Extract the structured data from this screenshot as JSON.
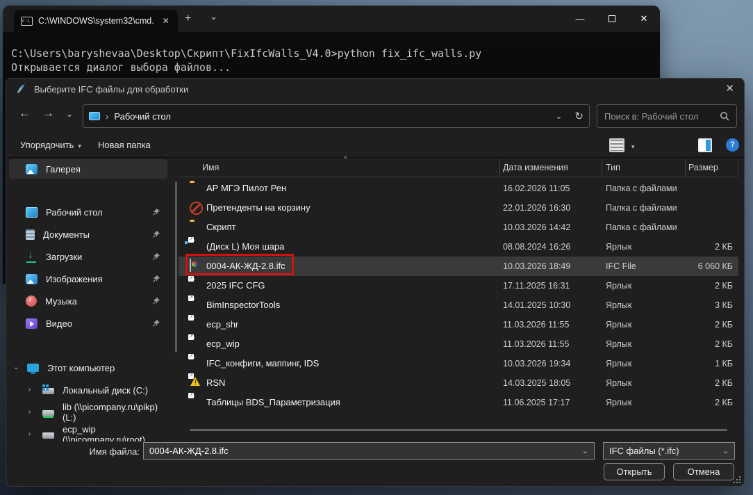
{
  "terminal": {
    "tab_title": "C:\\WINDOWS\\system32\\cmd.",
    "tab_close": "✕",
    "new_tab": "+",
    "tab_dropdown": "⌄",
    "minimize": "—",
    "close": "✕",
    "lines": [
      "C:\\Users\\baryshevaa\\Desktop\\Скрипт\\FixIfcWalls_V4.0>python fix_ifc_walls.py",
      "Открывается диалог выбора файлов..."
    ]
  },
  "dialog": {
    "title": "Выберите IFC файлы для обработки",
    "close": "✕",
    "nav": {
      "back": "←",
      "forward": "→",
      "recent": "⌄",
      "up": "↑"
    },
    "breadcrumb": {
      "sep": "›",
      "path": "Рабочий стол",
      "dropdown": "⌄",
      "refresh": "↻"
    },
    "search": {
      "placeholder": "Поиск в: Рабочий стол"
    },
    "toolbar": {
      "organize": "Упорядочить",
      "organize_caret": "▾",
      "new_folder": "Новая папка",
      "view_caret": "▾",
      "help": "?"
    },
    "sidebar": {
      "gallery": "Галерея",
      "quick": [
        {
          "label": "Рабочий стол",
          "icon": "si-desktop"
        },
        {
          "label": "Документы",
          "icon": "si-docs"
        },
        {
          "label": "Загрузки",
          "icon": "si-downloads"
        },
        {
          "label": "Изображения",
          "icon": "si-pictures"
        },
        {
          "label": "Музыка",
          "icon": "si-music"
        },
        {
          "label": "Видео",
          "icon": "si-video"
        }
      ],
      "tree_chevron_open": "⌄",
      "tree_chevron_closed": "›",
      "computer": "Этот компьютер",
      "drives": [
        {
          "label": "Локальный диск (C:)",
          "icon": "si-drive-c"
        },
        {
          "label": "lib (\\\\picompany.ru\\pikp) (L:)",
          "icon": "si-drive-net"
        },
        {
          "label": "ecp_wip (\\\\picompany.ru\\root)",
          "icon": "si-drive-plain"
        }
      ]
    },
    "list": {
      "sort_caret": "^",
      "columns": {
        "name": "Имя",
        "date": "Дата изменения",
        "type": "Тип",
        "size": "Размер"
      },
      "rows": [
        {
          "name": "АР МГЭ Пилот Рен",
          "date": "16.02.2026 11:05",
          "type": "Папка с файлами",
          "size": "",
          "icon": "ic-folder",
          "state": ""
        },
        {
          "name": "Претенденты на корзину",
          "date": "22.01.2026 16:30",
          "type": "Папка с файлами",
          "size": "",
          "icon": "ic-blocked",
          "state": ""
        },
        {
          "name": "Скрипт",
          "date": "10.03.2026 14:42",
          "type": "Папка с файлами",
          "size": "",
          "icon": "ic-folder",
          "state": ""
        },
        {
          "name": "(Диск L) Моя шара",
          "date": "08.08.2024 16:26",
          "type": "Ярлык",
          "size": "2 КБ",
          "icon": "ic-share-link",
          "state": ""
        },
        {
          "name": "0004-АК-ЖД-2.8.ifc",
          "date": "10.03.2026 18:49",
          "type": "IFC File",
          "size": "6 060 КБ",
          "icon": "ic-ifc",
          "state": "selected"
        },
        {
          "name": "2025 IFC CFG",
          "date": "17.11.2025 16:31",
          "type": "Ярлык",
          "size": "2 КБ",
          "icon": "ic-folder-link",
          "state": ""
        },
        {
          "name": "BimInspectorTools",
          "date": "14.01.2025 10:30",
          "type": "Ярлык",
          "size": "3 КБ",
          "icon": "ic-folder-link",
          "state": ""
        },
        {
          "name": "ecp_shr",
          "date": "11.03.2026 11:55",
          "type": "Ярлык",
          "size": "2 КБ",
          "icon": "ic-folder-link",
          "state": ""
        },
        {
          "name": "ecp_wip",
          "date": "11.03.2026 11:55",
          "type": "Ярлык",
          "size": "2 КБ",
          "icon": "ic-folder-link",
          "state": ""
        },
        {
          "name": "IFC_конфиги, маппинг, IDS",
          "date": "10.03.2026 19:34",
          "type": "Ярлык",
          "size": "1 КБ",
          "icon": "ic-folder-link",
          "state": ""
        },
        {
          "name": "RSN",
          "date": "14.03.2025 18:05",
          "type": "Ярлык",
          "size": "2 КБ",
          "icon": "ic-warn-link",
          "state": ""
        },
        {
          "name": "Таблицы BDS_Параметризация",
          "date": "11.06.2025 17:17",
          "type": "Ярлык",
          "size": "2 КБ",
          "icon": "ic-folder-link",
          "state": ""
        }
      ]
    },
    "footer": {
      "filename_label": "Имя файла:",
      "filename_value": "0004-АК-ЖД-2.8.ifc",
      "filetype_value": "IFC файлы (*.ifc)",
      "open": "Открыть",
      "cancel": "Отмена",
      "combo_chevron": "⌄"
    }
  }
}
